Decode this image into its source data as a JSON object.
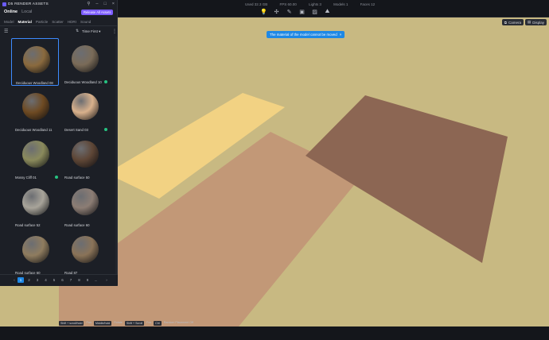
{
  "app": {
    "title": "D5 RENDER ASSETS",
    "window_controls": [
      "pin-icon",
      "minimize-icon",
      "maximize-icon",
      "close-icon"
    ]
  },
  "mode_tabs": [
    {
      "label": "Online",
      "active": true
    },
    {
      "label": "Local",
      "active": false
    }
  ],
  "release_badge": "Release All Assets",
  "category_tabs": [
    {
      "label": "Model",
      "active": false
    },
    {
      "label": "Material",
      "active": true
    },
    {
      "label": "Particle",
      "active": false
    },
    {
      "label": "Scatter",
      "active": false
    },
    {
      "label": "HDRI",
      "active": false
    },
    {
      "label": "Sound",
      "active": false
    }
  ],
  "filter": {
    "sort_label": "Time First"
  },
  "materials": [
    {
      "label": "Deciduous Woodland 08",
      "color": "#8a6a3e",
      "selected": true,
      "downloaded": false
    },
    {
      "label": "Deciduous Woodland 10",
      "color": "#7a6b58",
      "selected": false,
      "downloaded": true
    },
    {
      "label": "Deciduous Woodland 11",
      "color": "#6e4a22",
      "selected": false,
      "downloaded": false
    },
    {
      "label": "Desert Sand 03",
      "color": "#d9b18c",
      "selected": false,
      "downloaded": true
    },
    {
      "label": "Mossy Cliff 01",
      "color": "#8a8a5c",
      "selected": false,
      "downloaded": true
    },
    {
      "label": "Road surface 50",
      "color": "#5e4636",
      "selected": false,
      "downloaded": false
    },
    {
      "label": "Road surface 52",
      "color": "#a8a49a",
      "selected": false,
      "downloaded": false
    },
    {
      "label": "Road surface 60",
      "color": "#8c7d74",
      "selected": false,
      "downloaded": false
    },
    {
      "label": "Road surface 60",
      "color": "#8f7c5f",
      "selected": false,
      "downloaded": false
    },
    {
      "label": "Road 87",
      "color": "#8a7358",
      "selected": false,
      "downloaded": false
    }
  ],
  "pagination": {
    "pages": [
      "1",
      "2",
      "3",
      "4",
      "5",
      "6",
      "7",
      "8",
      "9",
      "..."
    ],
    "current": "1",
    "prev": "‹",
    "next": "›"
  },
  "topbar": {
    "stats": [
      "Used 32.3 GB",
      "FPS 60.00",
      "Lights 3",
      "Models 1",
      "Faces 12"
    ],
    "tools": [
      "light-icon",
      "move-icon",
      "pen-icon",
      "image-icon",
      "picture-icon",
      "landscape-icon"
    ]
  },
  "view_buttons": [
    {
      "label": "Camera",
      "icon": "camera-icon"
    },
    {
      "label": "Display",
      "icon": "display-icon"
    }
  ],
  "toast": {
    "text": "The material of the model cannot be moved",
    "close": "×"
  },
  "hints": [
    {
      "key": "Shift + scroll/hold",
      "label": "Pan"
    },
    {
      "key": "Middle/hold",
      "label": "Rotate"
    },
    {
      "key": "Shift + Scroll",
      "label": "Fov"
    },
    {
      "key": "Ctrl",
      "label": "Random Placement Off"
    }
  ],
  "scene": {
    "ground_color": "#c8b982",
    "plane_yellow": "#f2d283",
    "plane_orange": "#c29877",
    "plane_brown": "#8c6653"
  }
}
